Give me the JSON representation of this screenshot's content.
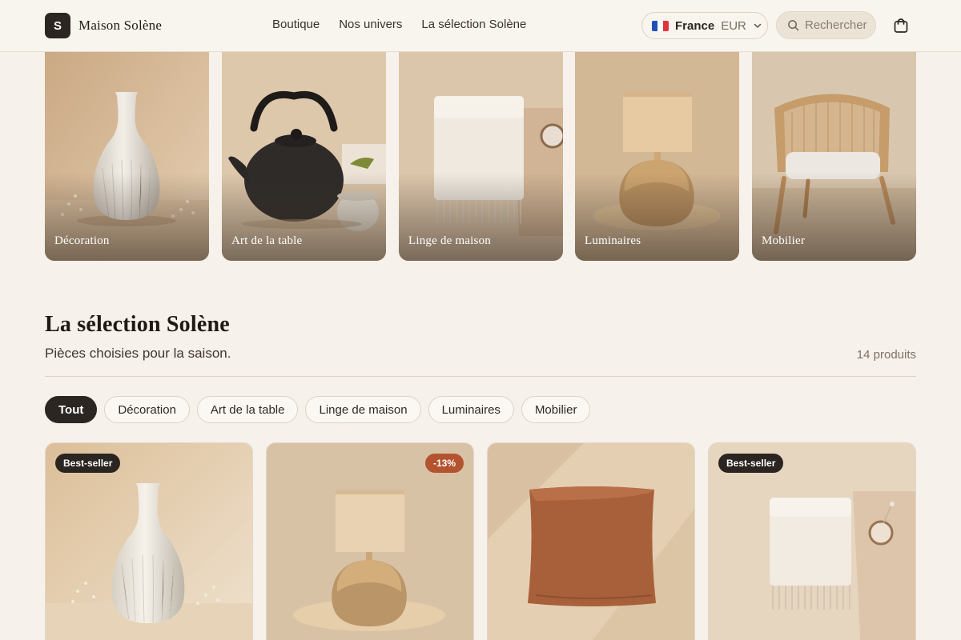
{
  "brand": {
    "logo_letter": "S",
    "name": "Maison Solène"
  },
  "nav": {
    "items": [
      "Boutique",
      "Nos univers",
      "La sélection Solène"
    ]
  },
  "locale": {
    "country": "France",
    "currency": "EUR",
    "flag_colors": [
      "#1f4fb8",
      "#ffffff",
      "#e0353a"
    ]
  },
  "search": {
    "placeholder": "Rechercher"
  },
  "categories": [
    {
      "label": "Décoration"
    },
    {
      "label": "Art de la table"
    },
    {
      "label": "Linge de maison"
    },
    {
      "label": "Luminaires"
    },
    {
      "label": "Mobilier"
    }
  ],
  "section": {
    "title": "La sélection Solène",
    "subtitle": "Pièces choisies pour la saison.",
    "count": "14 produits"
  },
  "filters": [
    "Tout",
    "Décoration",
    "Art de la table",
    "Linge de maison",
    "Luminaires",
    "Mobilier"
  ],
  "products": [
    {
      "badge": "Best-seller",
      "image": "white ribbed vase"
    },
    {
      "badge": "-13%",
      "image": "ceramic table lamp"
    },
    {
      "badge": "",
      "image": "terracotta cushion"
    },
    {
      "badge": "Best-seller",
      "image": "folded wool throw"
    }
  ],
  "colors": {
    "accent_dark": "#2b2622",
    "sale": "#b4532f",
    "background": "#f6f1ea"
  }
}
